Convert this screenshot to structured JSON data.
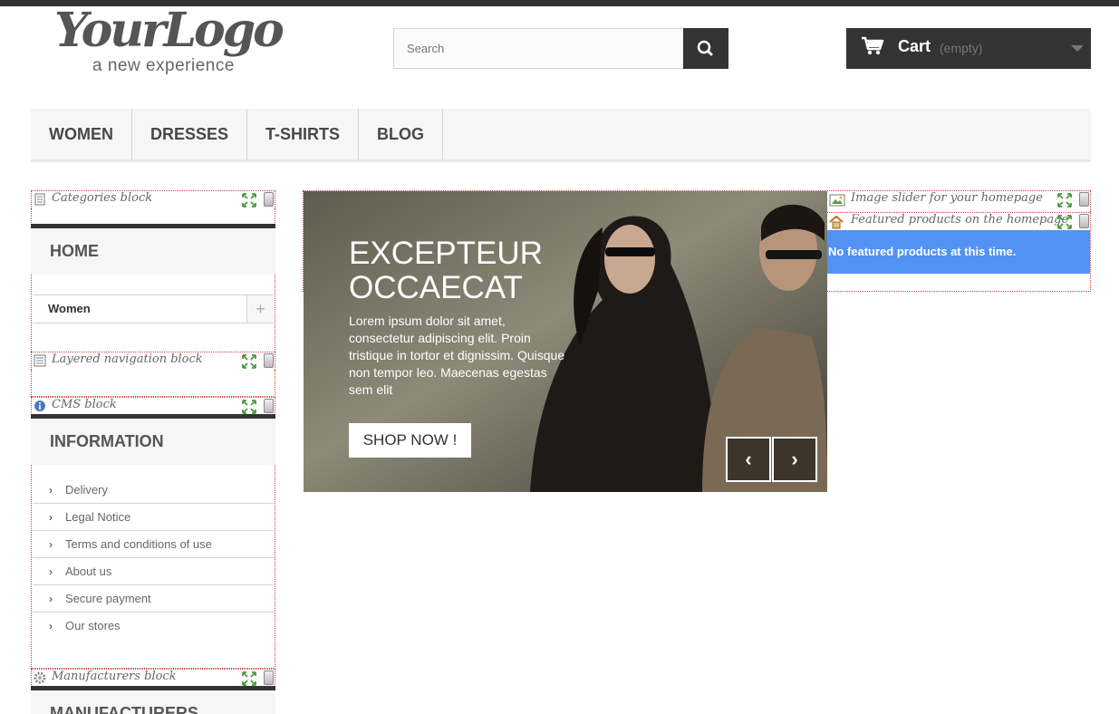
{
  "logo": {
    "script_text": "YourLogo",
    "tagline": "a new experience"
  },
  "search": {
    "placeholder": "Search",
    "button_icon": "search-icon"
  },
  "cart": {
    "label": "Cart",
    "status": "(empty)",
    "icon": "cart-icon"
  },
  "nav": {
    "items": [
      "WOMEN",
      "DRESSES",
      "T-SHIRTS",
      "BLOG"
    ]
  },
  "modules": {
    "categories": "Categories block",
    "layered": "Layered navigation block",
    "cms": "CMS block",
    "manufacturers": "Manufacturers block",
    "slider": "Image slider for your homepage",
    "featured": "Featured products on the homepage"
  },
  "categories": {
    "title": "HOME",
    "items": [
      "Women"
    ],
    "expand_symbol": "+"
  },
  "information": {
    "title": "INFORMATION",
    "links": [
      "Delivery",
      "Legal Notice",
      "Terms and conditions of use",
      "About us",
      "Secure payment",
      "Our stores"
    ]
  },
  "manufacturers": {
    "title": "MANUFACTURERS"
  },
  "slider": {
    "heading_line1": "EXCEPTEUR",
    "heading_line2": "OCCAECAT",
    "text": "Lorem ipsum dolor sit amet, consectetur adipiscing elit. Proin tristique in tortor et dignissim. Quisque non tempor leo. Maecenas egestas sem elit",
    "button": "SHOP NOW !",
    "prev_symbol": "‹",
    "next_symbol": "›"
  },
  "featured": {
    "message": "No featured products at this time."
  },
  "colors": {
    "dark": "#333333",
    "alert_blue": "#5192f3",
    "nav_bg": "#f6f6f6"
  }
}
